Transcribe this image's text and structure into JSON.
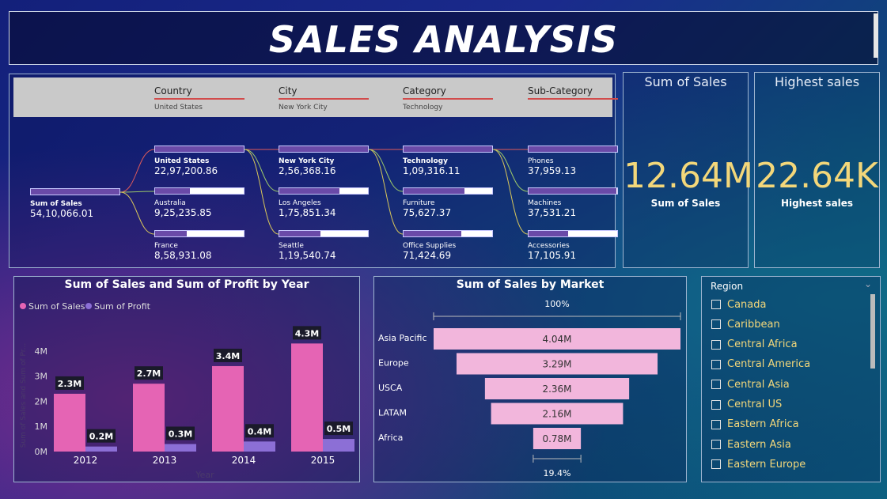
{
  "title": "SALES ANALYSIS",
  "decomposition": {
    "levels": [
      {
        "name": "Country",
        "selected": "United States"
      },
      {
        "name": "City",
        "selected": "New York City"
      },
      {
        "name": "Category",
        "selected": "Technology"
      },
      {
        "name": "Sub-Category",
        "selected": ""
      }
    ],
    "root": {
      "label": "Sum of Sales",
      "value": "54,10,066.01"
    },
    "columns": [
      [
        {
          "label": "United States",
          "value": "22,97,200.86",
          "bold": true,
          "fill": 1.0
        },
        {
          "label": "Australia",
          "value": "9,25,235.85",
          "bold": false,
          "fill": 0.39
        },
        {
          "label": "France",
          "value": "8,58,931.08",
          "bold": false,
          "fill": 0.36
        }
      ],
      [
        {
          "label": "New York City",
          "value": "2,56,368.16",
          "bold": true,
          "fill": 1.0
        },
        {
          "label": "Los Angeles",
          "value": "1,75,851.34",
          "bold": false,
          "fill": 0.68
        },
        {
          "label": "Seattle",
          "value": "1,19,540.74",
          "bold": false,
          "fill": 0.46
        }
      ],
      [
        {
          "label": "Technology",
          "value": "1,09,316.11",
          "bold": true,
          "fill": 1.0
        },
        {
          "label": "Furniture",
          "value": "75,627.37",
          "bold": false,
          "fill": 0.69
        },
        {
          "label": "Office Supplies",
          "value": "71,424.69",
          "bold": false,
          "fill": 0.65
        }
      ],
      [
        {
          "label": "Phones",
          "value": "37,959.13",
          "bold": false,
          "fill": 1.0
        },
        {
          "label": "Machines",
          "value": "37,531.21",
          "bold": false,
          "fill": 0.99
        },
        {
          "label": "Accessories",
          "value": "17,105.91",
          "bold": false,
          "fill": 0.45
        }
      ]
    ]
  },
  "kpis": [
    {
      "title": "Sum of Sales",
      "value": "12.64M",
      "label": "Sum of Sales"
    },
    {
      "title": "Highest sales",
      "value": "22.64K",
      "label": "Highest sales"
    }
  ],
  "year_chart": {
    "title": "Sum of Sales and Sum of Profit by Year",
    "legend": [
      "Sum of Sales",
      "Sum of Profit"
    ],
    "ylabel": "Sum of Sales and Sum of Pr...",
    "xlabel": "Year",
    "ytick_labels": [
      "0M",
      "1M",
      "2M",
      "3M",
      "4M"
    ],
    "colors": {
      "sales": "#e564b4",
      "profit": "#8c6fd6"
    }
  },
  "market_chart": {
    "title": "Sum of Sales by Market",
    "top_label": "100%",
    "bottom_label": "19.4%",
    "color": "#f2b6dc"
  },
  "chart_data": [
    {
      "type": "bar",
      "title": "Sum of Sales and Sum of Profit by Year",
      "categories": [
        "2012",
        "2013",
        "2014",
        "2015"
      ],
      "series": [
        {
          "name": "Sum of Sales",
          "values": [
            2.3,
            2.7,
            3.4,
            4.3
          ],
          "labels": [
            "2.3M",
            "2.7M",
            "3.4M",
            "4.3M"
          ]
        },
        {
          "name": "Sum of Profit",
          "values": [
            0.2,
            0.3,
            0.4,
            0.5
          ],
          "labels": [
            "0.2M",
            "0.3M",
            "0.4M",
            "0.5M"
          ]
        }
      ],
      "xlabel": "Year",
      "ylabel": "Sum of Sales and Sum of Pr...",
      "ylim": [
        0,
        4.5
      ],
      "legend": "top-left"
    },
    {
      "type": "bar",
      "title": "Sum of Sales by Market",
      "categories": [
        "Asia Pacific",
        "Europe",
        "USCA",
        "LATAM",
        "Africa"
      ],
      "values": [
        4.04,
        3.29,
        2.36,
        2.16,
        0.78
      ],
      "labels": [
        "4.04M",
        "3.29M",
        "2.36M",
        "2.16M",
        "0.78M"
      ]
    }
  ],
  "region_slicer": {
    "title": "Region",
    "items": [
      "Canada",
      "Caribbean",
      "Central Africa",
      "Central America",
      "Central Asia",
      "Central US",
      "Eastern Africa",
      "Eastern Asia",
      "Eastern Europe"
    ]
  }
}
